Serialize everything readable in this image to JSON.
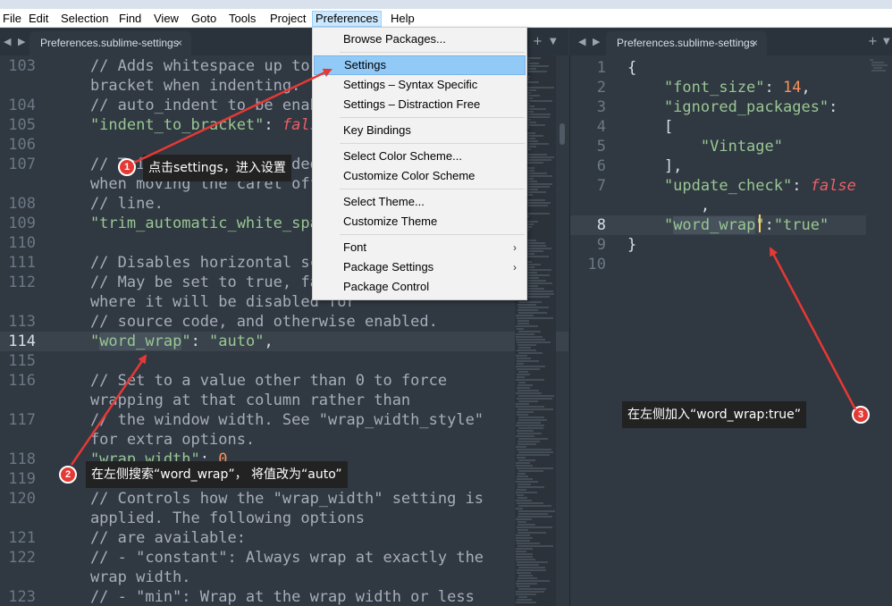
{
  "menubar": {
    "items": [
      "File",
      "Edit",
      "Selection",
      "Find",
      "View",
      "Goto",
      "Tools",
      "Project",
      "Preferences",
      "Help"
    ],
    "active": "Preferences"
  },
  "left_tab": {
    "title": "Preferences.sublime-settings",
    "close": "×"
  },
  "right_tab": {
    "title": "Preferences.sublime-settings",
    "close": "×"
  },
  "tab_nav": "◀ ▶",
  "tab_plus": "+",
  "tab_more": "▼",
  "left_editor": {
    "lines": [
      {
        "num": "103",
        "parts": [
          [
            "comment",
            "    // Adds whitespace up to the"
          ]
        ]
      },
      {
        "num": "",
        "parts": [
          [
            "comment",
            "    bracket when indenting."
          ]
        ]
      },
      {
        "num": "104",
        "parts": [
          [
            "comment",
            "    // auto_indent to be enabled"
          ]
        ]
      },
      {
        "num": "105",
        "parts": [
          [
            "string",
            "    \"indent_to_bracket\""
          ],
          [
            "punct",
            ": "
          ],
          [
            "false",
            "false"
          ],
          [
            "punct",
            ","
          ]
        ]
      },
      {
        "num": "106",
        "parts": []
      },
      {
        "num": "107",
        "parts": [
          [
            "comment",
            "    // Trim white space added by"
          ]
        ]
      },
      {
        "num": "",
        "parts": [
          [
            "comment",
            "    when moving the caret off the"
          ]
        ]
      },
      {
        "num": "108",
        "parts": [
          [
            "comment",
            "    // line."
          ]
        ]
      },
      {
        "num": "109",
        "parts": [
          [
            "string",
            "    \"trim_automatic_white_space\""
          ],
          [
            "punct",
            ": "
          ]
        ]
      },
      {
        "num": "110",
        "parts": []
      },
      {
        "num": "111",
        "parts": [
          [
            "comment",
            "    // Disables horizontal scrolling"
          ]
        ]
      },
      {
        "num": "112",
        "parts": [
          [
            "comment",
            "    // May be set to true, false"
          ]
        ]
      },
      {
        "num": "",
        "parts": [
          [
            "comment",
            "    where it will be disabled for"
          ]
        ]
      },
      {
        "num": "113",
        "parts": [
          [
            "comment",
            "    // source code, and otherwise enabled."
          ]
        ]
      },
      {
        "num": "114",
        "parts": [
          [
            "string",
            "    \""
          ],
          [
            "stringhl",
            "word_wrap"
          ],
          [
            "string",
            "\""
          ],
          [
            "punct",
            ": "
          ],
          [
            "string",
            "\"auto\""
          ],
          [
            "punct",
            ","
          ]
        ]
      },
      {
        "num": "115",
        "parts": []
      },
      {
        "num": "116",
        "parts": [
          [
            "comment",
            "    // Set to a value other than 0 to force"
          ]
        ]
      },
      {
        "num": "",
        "parts": [
          [
            "comment",
            "    wrapping at that column rather than"
          ]
        ]
      },
      {
        "num": "117",
        "parts": [
          [
            "comment",
            "    // the window width. See \"wrap_width_style\""
          ]
        ]
      },
      {
        "num": "",
        "parts": [
          [
            "comment",
            "    for extra options."
          ]
        ]
      },
      {
        "num": "118",
        "parts": [
          [
            "string",
            "    \"wrap_width\""
          ],
          [
            "punct",
            ": "
          ],
          [
            "number",
            "0"
          ],
          [
            "punct",
            ","
          ]
        ]
      },
      {
        "num": "119",
        "parts": []
      },
      {
        "num": "120",
        "parts": [
          [
            "comment",
            "    // Controls how the \"wrap_width\" setting is"
          ]
        ]
      },
      {
        "num": "",
        "parts": [
          [
            "comment",
            "    applied. The following options"
          ]
        ]
      },
      {
        "num": "121",
        "parts": [
          [
            "comment",
            "    // are available:"
          ]
        ]
      },
      {
        "num": "122",
        "parts": [
          [
            "comment",
            "    // - \"constant\": Always wrap at exactly the"
          ]
        ]
      },
      {
        "num": "",
        "parts": [
          [
            "comment",
            "    wrap width."
          ]
        ]
      },
      {
        "num": "123",
        "parts": [
          [
            "comment",
            "    // - \"min\": Wrap at the wrap width or less"
          ]
        ]
      }
    ],
    "current_line_num": "114"
  },
  "right_editor": {
    "lines": [
      {
        "num": "1",
        "parts": [
          [
            "punct",
            "{"
          ]
        ]
      },
      {
        "num": "2",
        "parts": [
          [
            "string",
            "    \"font_size\""
          ],
          [
            "punct",
            ": "
          ],
          [
            "number",
            "14"
          ],
          [
            "punct",
            ","
          ]
        ]
      },
      {
        "num": "3",
        "parts": [
          [
            "string",
            "    \"ignored_packages\""
          ],
          [
            "punct",
            ":"
          ]
        ]
      },
      {
        "num": "4",
        "parts": [
          [
            "punct",
            "    ["
          ]
        ]
      },
      {
        "num": "5",
        "parts": [
          [
            "string",
            "        \"Vintage\""
          ]
        ]
      },
      {
        "num": "6",
        "parts": [
          [
            "punct",
            "    ],"
          ]
        ]
      },
      {
        "num": "7",
        "parts": [
          [
            "string",
            "    \"update_check\""
          ],
          [
            "punct",
            ": "
          ],
          [
            "false",
            "false"
          ]
        ]
      },
      {
        "num": "",
        "parts": [
          [
            "punct",
            "        ,"
          ]
        ]
      },
      {
        "num": "8",
        "parts": [
          [
            "string",
            "    \""
          ],
          [
            "stringhl",
            "word_wrap"
          ],
          [
            "string",
            "\""
          ],
          [
            "punct",
            ":"
          ],
          [
            "string",
            "\"true\""
          ]
        ]
      },
      {
        "num": "9",
        "parts": [
          [
            "punct",
            "}"
          ]
        ]
      },
      {
        "num": "10",
        "parts": []
      }
    ],
    "current_line_num": "8"
  },
  "dropdown": {
    "items": [
      {
        "label": "Browse Packages...",
        "submenu": false
      },
      {
        "sep": true
      },
      {
        "label": "Settings",
        "submenu": false,
        "selected": true
      },
      {
        "label": "Settings – Syntax Specific",
        "submenu": false
      },
      {
        "label": "Settings – Distraction Free",
        "submenu": false
      },
      {
        "sep": true
      },
      {
        "label": "Key Bindings",
        "submenu": false
      },
      {
        "sep": true
      },
      {
        "label": "Select Color Scheme...",
        "submenu": false
      },
      {
        "label": "Customize Color Scheme",
        "submenu": false
      },
      {
        "sep": true
      },
      {
        "label": "Select Theme...",
        "submenu": false
      },
      {
        "label": "Customize Theme",
        "submenu": false
      },
      {
        "sep": true
      },
      {
        "label": "Font",
        "submenu": true
      },
      {
        "label": "Package Settings",
        "submenu": true
      },
      {
        "label": "Package Control",
        "submenu": false
      }
    ],
    "submenu_glyph": "›"
  },
  "annotations": {
    "callout1": {
      "badge": "1",
      "text": "点击settings，进入设置"
    },
    "callout2": {
      "badge": "2",
      "text": "在左侧搜索“word_wrap”， 将值改为“auto”"
    },
    "callout3": {
      "badge": "3",
      "text": "在左侧加入“word_wrap:true”"
    }
  },
  "colors": {
    "editor_bg": "#303841",
    "comment": "#a7adba",
    "string": "#99c794",
    "number": "#f99157",
    "false": "#ec5f67",
    "annotation_red": "#e53935",
    "menu_highlight": "#91c9f7"
  }
}
